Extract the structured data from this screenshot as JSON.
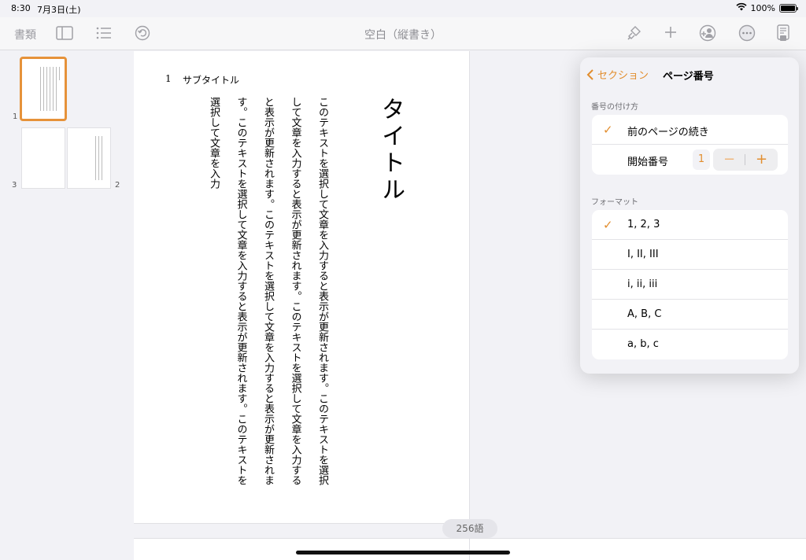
{
  "status_bar": {
    "time": "8:30",
    "date": "7月3日(土)",
    "battery": "100%"
  },
  "toolbar": {
    "documents_label": "書類",
    "title": "空白（縦書き）"
  },
  "thumbnails": [
    {
      "page": "1"
    },
    {
      "page": "3"
    },
    {
      "page": "2"
    }
  ],
  "document": {
    "page_number": "1",
    "subtitle": "サブタイトル",
    "title": "タイトル",
    "body": "このテキストを選択して文章を入力すると表示が更新されます。このテキストを選択して文章を入力すると表示が更新されます。このテキストを選択して文章を入力すると表示が更新されます。このテキストを選択して文章を入力すると表示が更新されます。このテキストを選択して文章を入力すると表示が更新されます。このテキストを選択して文章を入力"
  },
  "word_count": "256語",
  "popover": {
    "back_label": "セクション",
    "title": "ページ番号",
    "numbering_section": "番号の付け方",
    "continue_label": "前のページの続き",
    "start_number_label": "開始番号",
    "start_number_value": "1",
    "format_section": "フォーマット",
    "formats": [
      {
        "label": "1, 2, 3",
        "selected": true
      },
      {
        "label": "I, II, III",
        "selected": false
      },
      {
        "label": "i, ii, iii",
        "selected": false
      },
      {
        "label": "A, B, C",
        "selected": false
      },
      {
        "label": "a, b, c",
        "selected": false
      }
    ]
  },
  "colors": {
    "accent": "#e28e2f"
  },
  "icons": [
    "sidebar-icon",
    "list-icon",
    "undo-icon",
    "paintbrush-icon",
    "plus-icon",
    "collaborate-icon",
    "more-icon",
    "document-setup-icon"
  ]
}
